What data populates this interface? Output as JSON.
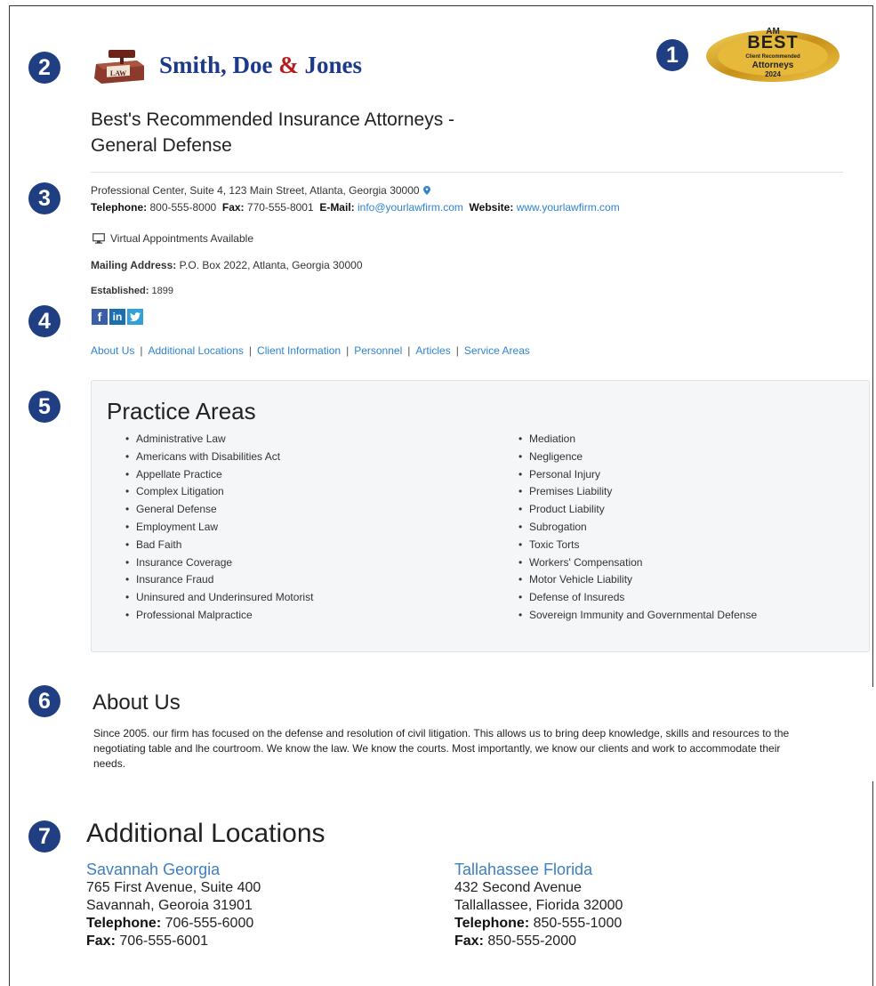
{
  "markers": [
    "1",
    "2",
    "3",
    "4",
    "5",
    "6",
    "7"
  ],
  "logo": {
    "name_part1": "Smith, Doe ",
    "amp": "&",
    "name_part2": " Jones",
    "icon_label": "LAW"
  },
  "badge": {
    "am": "AM",
    "best": "BEST",
    "line1": "Client Recommended",
    "line2": "Attorneys",
    "year": "2024"
  },
  "title": {
    "line1": "Best's Recommended Insurance Attorneys -",
    "line2": "General Defense"
  },
  "address": "Professional Center, Suite 4, 123 Main Street, Atlanta, Georgia 30000",
  "contact": {
    "telephone_label": "Telephone:",
    "telephone": "800-555-8000",
    "fax_label": "Fax:",
    "fax": "770-555-8001",
    "email_label": "E-Mail:",
    "email": "info@yourlawfirm.com",
    "website_label": "Website:",
    "website": "www.yourlawfirm.com"
  },
  "virtual": "Virtual Appointments Available",
  "mailing": {
    "label": "Mailing Address:",
    "value": "P.O. Box 2022, Atlanta, Georgia 30000"
  },
  "established": {
    "label": "Established:",
    "value": "1899"
  },
  "social": {
    "facebook": "f",
    "linkedin": "in",
    "twitter": "t"
  },
  "nav": [
    "About Us",
    "Additional Locations",
    "Client Information",
    "Personnel",
    "Articles",
    "Service Areas"
  ],
  "practice": {
    "heading": "Practice Areas",
    "left": [
      "Administrative Law",
      "Americans with Disabilities Act",
      "Appellate Practice",
      "Complex Litigation",
      "General Defense",
      "Employment Law",
      "Bad Faith",
      "Insurance Coverage",
      "Insurance Fraud",
      "Uninsured and Underinsured Motorist",
      "Professional Malpractice"
    ],
    "right": [
      "Mediation",
      "Negligence",
      "Personal Injury",
      "Premises Liability",
      "Product Liability",
      "Subrogation",
      "Toxic Torts",
      "Workers' Compensation",
      "Motor Vehicle Liability",
      "Defense of Insureds",
      "Sovereign Immunity and Governmental Defense"
    ]
  },
  "about": {
    "heading": "About Us",
    "text": "Since 2005. our firm has focused on the defense and resolution of civil litigation. This allows us to bring deep knowledge, skills and resources to the negotiating table and lhe courtroom. We know the law. We know the courts. Most importantly, we know our clients and work to accommodate their needs."
  },
  "locations": {
    "heading": "Additional Locations",
    "items": [
      {
        "city": "Savannah Georgia",
        "street": "765 First Avenue, Suite 400",
        "citystate": "Savannah, Georoia 31901",
        "telephone_label": "Telephone:",
        "telephone": "706-555-6000",
        "fax_label": "Fax:",
        "fax": "706-555-6001"
      },
      {
        "city": "Tallahassee Florida",
        "street": "432 Second Avenue",
        "citystate": "Tallallassee, Fiorida 32000",
        "telephone_label": "Telephone:",
        "telephone": "850-555-1000",
        "fax_label": "Fax:",
        "fax": "850-555-2000"
      }
    ]
  },
  "colors": {
    "marker": "#1f3f82",
    "link": "#2f84d0",
    "brand": "#1d3a8a",
    "badge_gold": "#d7a51e"
  }
}
